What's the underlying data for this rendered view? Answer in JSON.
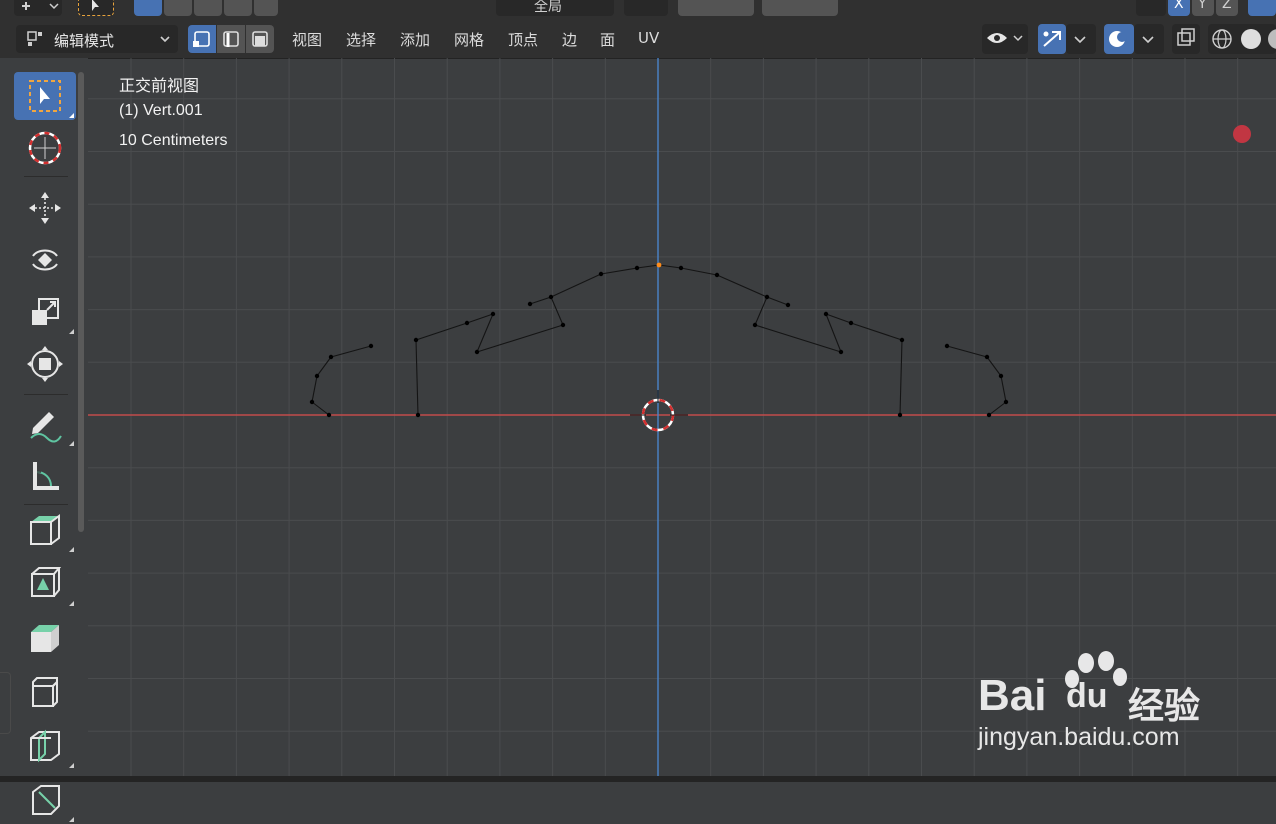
{
  "header": {
    "top_pivot_label": "全局",
    "axis_x": "X",
    "axis_y": "Y",
    "axis_z": "Z",
    "mode_label": "编辑模式",
    "menu": [
      "视图",
      "选择",
      "添加",
      "网格",
      "顶点",
      "边",
      "面",
      "UV"
    ]
  },
  "overlay": {
    "view_name": "正交前视图",
    "object_info": "(1) Vert.001",
    "scale_info": "10 Centimeters"
  },
  "watermark": {
    "logo_text": "Bai",
    "logo_text2": "du",
    "cn_text": "经验",
    "url": "jingyan.baidu.com"
  },
  "colors": {
    "accent": "#4772b3",
    "x_axis": "#c24b4b",
    "z_axis": "#4a84c9",
    "vertex_selected": "#ff8c1a",
    "record_dot": "#c13642"
  },
  "icons": {
    "tools": [
      "select-box-icon",
      "cursor-icon",
      "move-icon",
      "rotate-icon",
      "scale-icon",
      "transform-icon",
      "annotate-icon",
      "measure-icon",
      "add-cube-icon",
      "extrude-icon",
      "inset-icon",
      "bevel-icon",
      "loop-cut-icon",
      "knife-icon"
    ]
  }
}
